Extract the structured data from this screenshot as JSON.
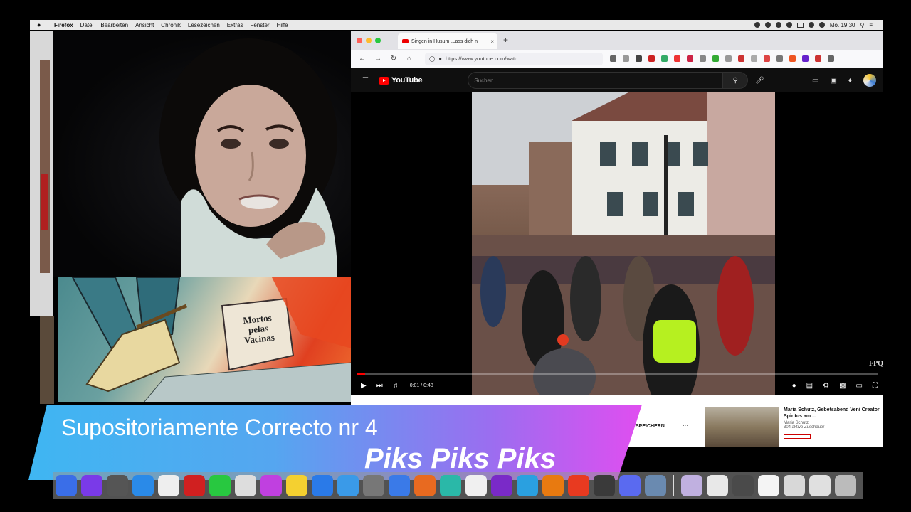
{
  "menubar": {
    "app": "Firefox",
    "items": [
      "Datei",
      "Bearbeiten",
      "Ansicht",
      "Chronik",
      "Lesezeichen",
      "Extras",
      "Fenster",
      "Hilfe"
    ],
    "clock": "Mo. 19:30"
  },
  "cartoon": {
    "note_line1": "Mortos",
    "note_line2": "pelas",
    "note_line3": "Vacinas"
  },
  "browser": {
    "tab_title": "Singen in Husum „Lass dich n",
    "new_tab": "+",
    "url": "https://www.youtube.com/watc"
  },
  "youtube": {
    "logo": "YouTube",
    "search_placeholder": "Suchen",
    "time": "0:01 / 0:48",
    "watermark": "FPQ",
    "progress": 0.016,
    "save_label": "SPEICHERN",
    "more_label": "···",
    "rec_title": "Maria Schutz, Gebetsabend Veni Creator Spiritus am ...",
    "rec_channel": "Maria Schutz",
    "rec_viewers": "304 aktive Zuschauer"
  },
  "banner": {
    "title": "Supositoriamente Correcto nr 4",
    "subtitle": "Piks Piks Piks"
  },
  "colors": {
    "yt_red": "#ff0000",
    "banner_start": "#3fb6f2",
    "banner_end": "#e04ef0"
  }
}
